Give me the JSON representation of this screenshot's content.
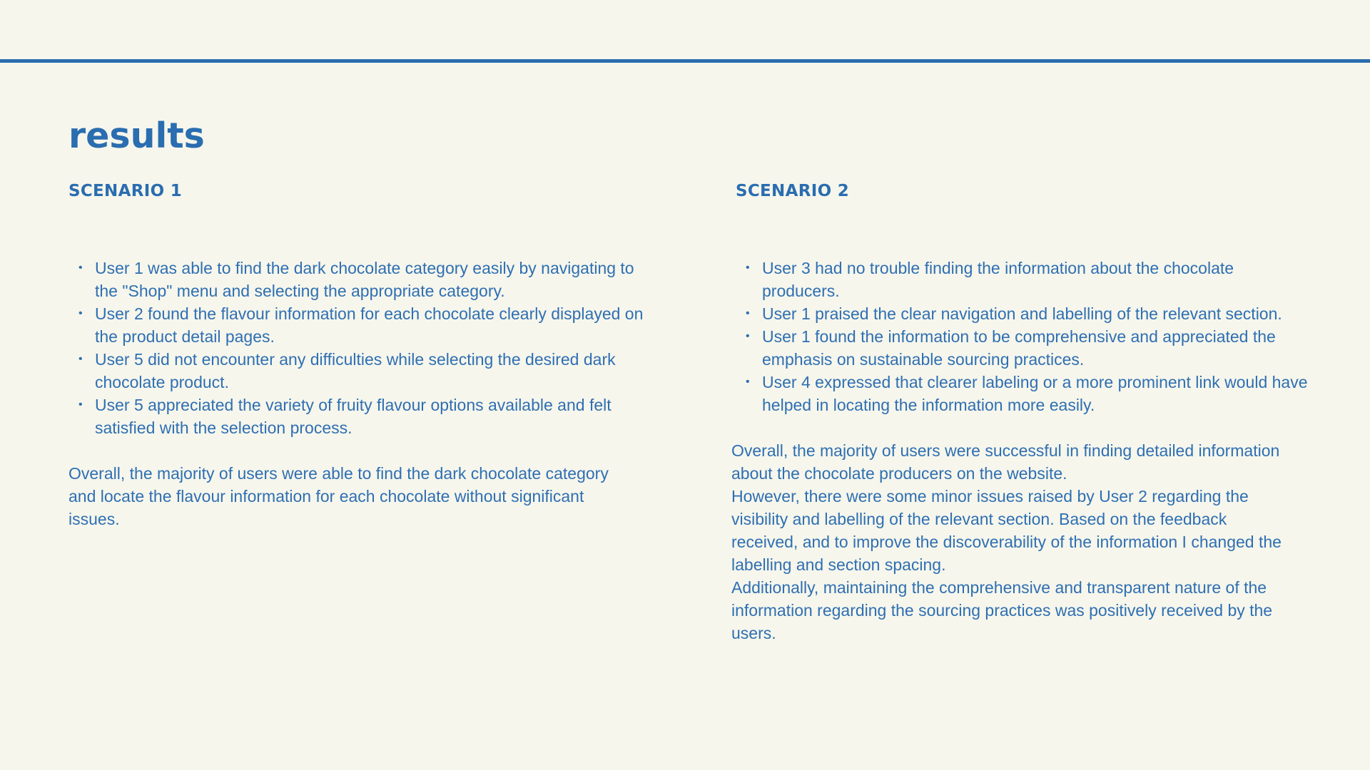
{
  "page": {
    "title": "results"
  },
  "scenario1": {
    "heading": "SCENARIO 1",
    "bullets": [
      "User 1 was able to find the dark chocolate category easily by navigating to the \"Shop\" menu and selecting the appropriate category.",
      "User 2 found the flavour information for each chocolate clearly displayed on the product detail pages.",
      "User 5 did not encounter any difficulties while selecting the desired dark chocolate product.",
      "User 5 appreciated the variety of fruity flavour options available and felt satisfied with the selection process."
    ],
    "summary": [
      "Overall, the majority of users were able to find the dark chocolate category and locate the flavour information for each chocolate without significant issues."
    ]
  },
  "scenario2": {
    "heading": "SCENARIO 2",
    "bullets": [
      "User 3 had no trouble finding the information about the chocolate producers.",
      "User 1 praised the clear navigation and labelling of the relevant section.",
      "User 1 found the information to be comprehensive and appreciated the emphasis on sustainable sourcing practices.",
      "User 4 expressed that clearer labeling or a more prominent link would have helped in locating the information more easily."
    ],
    "summary": [
      "Overall, the majority of users were successful in finding detailed information about the chocolate producers on the website.",
      "However, there were some minor issues raised by User 2 regarding the visibility and labelling of the relevant section. Based on the feedback received, and to improve the discoverability of the information I changed the labelling and section spacing.",
      "Additionally, maintaining the comprehensive and transparent nature of the information regarding the sourcing practices was positively received by the users."
    ]
  },
  "colors": {
    "background": "#f6f6ec",
    "accent": "#2a6db0",
    "text": "#2f6fb2"
  },
  "icons": {
    "bullet": "bullet-dot-icon"
  }
}
